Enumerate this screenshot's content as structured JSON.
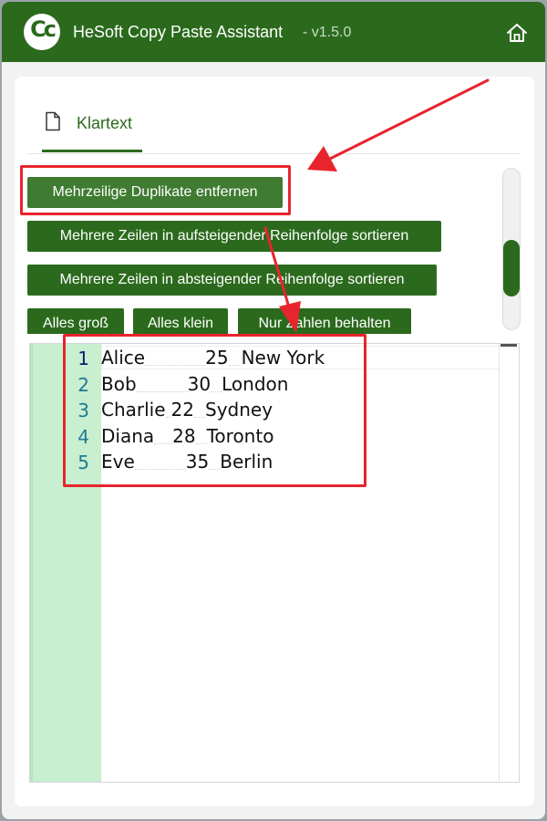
{
  "window": {
    "title": "HeSoft Copy Paste Assistant",
    "version": "- v1.5.0",
    "logo_text": "Cc"
  },
  "tabs": [
    {
      "label": "Klartext",
      "icon": "document-icon",
      "active": true
    }
  ],
  "buttons": {
    "remove_duplicates": "Mehrzeilige Duplikate entfernen",
    "sort_asc": "Mehrere Zeilen in aufsteigender Reihenfolge sortieren",
    "sort_desc": "Mehrere Zeilen in absteigender Reihenfolge sortieren",
    "upper": "Alles groß",
    "lower": "Alles klein",
    "numbers_only": "Nur Zahlen behalten"
  },
  "editor": {
    "lines": [
      {
        "no": "1",
        "name": "Alice",
        "age": "25",
        "city": "New York"
      },
      {
        "no": "2",
        "name": "Bob",
        "age": "30",
        "city": "London"
      },
      {
        "no": "3",
        "name": "Charlie",
        "age": "22",
        "city": "Sydney"
      },
      {
        "no": "4",
        "name": "Diana",
        "age": "28",
        "city": "Toronto"
      },
      {
        "no": "5",
        "name": "Eve",
        "age": "35",
        "city": "Berlin"
      }
    ]
  },
  "colors": {
    "brand_green": "#2b6a1d",
    "gutter_green": "#c7efd0",
    "annotation_red": "#e8242c",
    "line_number": "#237893"
  },
  "icons": {
    "home": "home-icon",
    "tab": "document-icon",
    "logo": "app-logo-icon"
  }
}
